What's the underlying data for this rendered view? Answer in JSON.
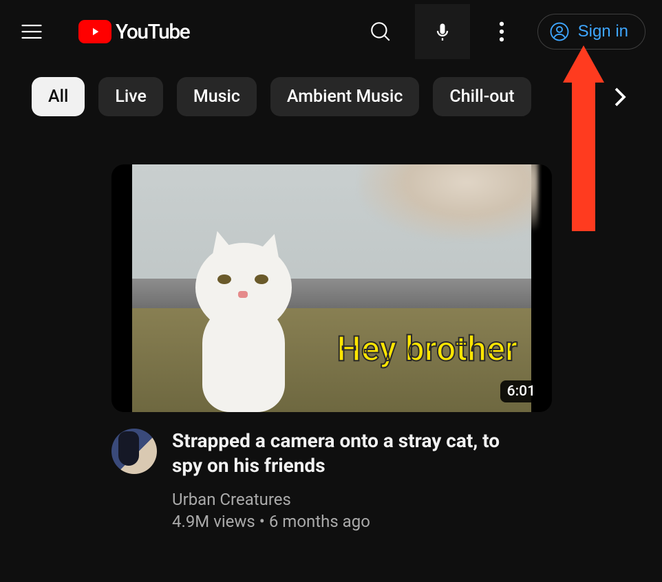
{
  "header": {
    "logo_text": "YouTube",
    "sign_in_label": "Sign in"
  },
  "chips": {
    "items": [
      {
        "label": "All",
        "active": true
      },
      {
        "label": "Live",
        "active": false
      },
      {
        "label": "Music",
        "active": false
      },
      {
        "label": "Ambient Music",
        "active": false
      },
      {
        "label": "Chill-out",
        "active": false
      }
    ]
  },
  "feed": {
    "video": {
      "thumb_caption": "Hey brother",
      "duration": "6:01",
      "title": "Strapped a camera onto a stray cat, to spy on his friends",
      "channel": "Urban Creatures",
      "views": "4.9M views",
      "sep": " • ",
      "age": "6 months ago"
    }
  },
  "annotation": {
    "target": "sign-in-button",
    "color": "#ff3b1f"
  }
}
